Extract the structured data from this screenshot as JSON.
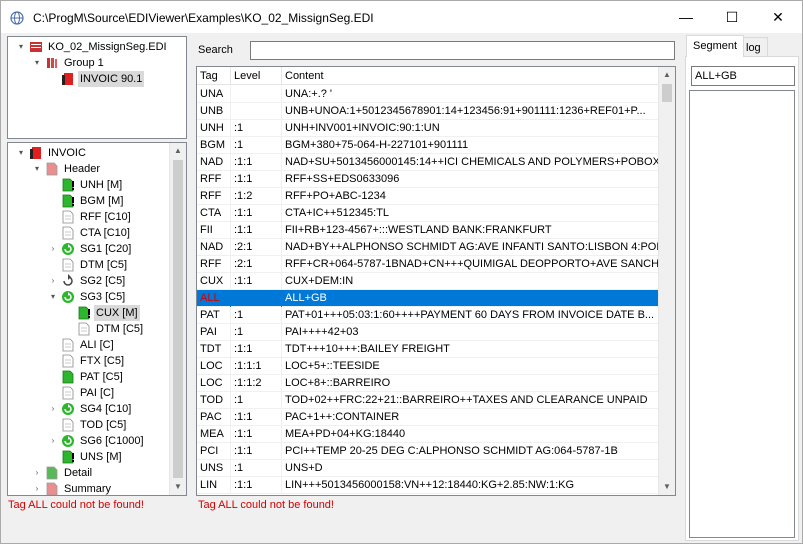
{
  "window": {
    "title": "C:\\ProgM\\Source\\EDIViewer\\Examples\\KO_02_MissignSeg.EDI",
    "minimize": "—",
    "maximize": "☐",
    "close": "✕"
  },
  "file_tree": {
    "items": [
      {
        "label": "KO_02_MissignSeg.EDI",
        "icon": "edi-file-icon",
        "level": 0,
        "arrow": "▾"
      },
      {
        "label": "Group 1",
        "icon": "group-icon",
        "level": 1,
        "arrow": "▾"
      },
      {
        "label": "INVOIC 90.1",
        "icon": "invoic-icon",
        "level": 2,
        "arrow": ""
      }
    ]
  },
  "segment_tree": {
    "items": [
      {
        "label": "INVOIC",
        "icon": "invoic-red-icon",
        "level": 0,
        "arrow": "▾"
      },
      {
        "label": "Header",
        "icon": "header-icon",
        "level": 1,
        "arrow": "▾"
      },
      {
        "label": "UNH [M]",
        "icon": "green-doc-warning-icon",
        "level": 2,
        "arrow": ""
      },
      {
        "label": "BGM [M]",
        "icon": "green-doc-warning-icon",
        "level": 2,
        "arrow": ""
      },
      {
        "label": "RFF [C10]",
        "icon": "white-doc-icon",
        "level": 2,
        "arrow": ""
      },
      {
        "label": "CTA [C10]",
        "icon": "white-doc-icon",
        "level": 2,
        "arrow": ""
      },
      {
        "label": "SG1 [C20]",
        "icon": "green-cycle-icon",
        "level": 2,
        "arrow": "›"
      },
      {
        "label": "DTM [C5]",
        "icon": "white-doc-icon",
        "level": 2,
        "arrow": ""
      },
      {
        "label": "SG2 [C5]",
        "icon": "gray-cycle-icon",
        "level": 2,
        "arrow": "›"
      },
      {
        "label": "SG3 [C5]",
        "icon": "green-cycle-icon",
        "level": 2,
        "arrow": "▾"
      },
      {
        "label": "CUX [M]",
        "icon": "green-doc-warning-icon",
        "level": 3,
        "arrow": ""
      },
      {
        "label": "DTM [C5]",
        "icon": "white-doc-icon",
        "level": 3,
        "arrow": ""
      },
      {
        "label": "ALI [C]",
        "icon": "white-doc-icon",
        "level": 2,
        "arrow": ""
      },
      {
        "label": "FTX [C5]",
        "icon": "white-doc-icon",
        "level": 2,
        "arrow": ""
      },
      {
        "label": "PAT [C5]",
        "icon": "green-doc-icon",
        "level": 2,
        "arrow": ""
      },
      {
        "label": "PAI [C]",
        "icon": "white-doc-icon",
        "level": 2,
        "arrow": ""
      },
      {
        "label": "SG4 [C10]",
        "icon": "green-cycle-icon",
        "level": 2,
        "arrow": "›"
      },
      {
        "label": "TOD [C5]",
        "icon": "white-doc-icon",
        "level": 2,
        "arrow": ""
      },
      {
        "label": "SG6 [C1000]",
        "icon": "green-cycle-icon",
        "level": 2,
        "arrow": "›"
      },
      {
        "label": "UNS [M]",
        "icon": "green-doc-warning-icon",
        "level": 2,
        "arrow": ""
      },
      {
        "label": "Detail",
        "icon": "detail-icon",
        "level": 1,
        "arrow": "›"
      },
      {
        "label": "Summary",
        "icon": "summary-icon",
        "level": 1,
        "arrow": "›"
      }
    ]
  },
  "left_error": "Tag ALL could not be found!",
  "search": {
    "label": "Search",
    "value": ""
  },
  "grid": {
    "headers": [
      "Tag",
      "Level",
      "Content"
    ],
    "rows": [
      {
        "tag": "UNA",
        "level": "",
        "content": "UNA:+.? '"
      },
      {
        "tag": "UNB",
        "level": "",
        "content": "UNB+UNOA:1+5012345678901:14+123456:91+901111:1236+REF01+P..."
      },
      {
        "tag": "UNH",
        "level": ":1",
        "content": "UNH+INV001+INVOIC:90:1:UN"
      },
      {
        "tag": "BGM",
        "level": ":1",
        "content": "BGM+380+75-064-H-227101+901111"
      },
      {
        "tag": "NAD",
        "level": ":1:1",
        "content": "NAD+SU+5013456000145:14++ICI CHEMICALS AND POLYMERS+POBOX..."
      },
      {
        "tag": "RFF",
        "level": ":1:1",
        "content": "RFF+SS+EDS0633096"
      },
      {
        "tag": "RFF",
        "level": ":1:2",
        "content": "RFF+PO+ABC-1234"
      },
      {
        "tag": "CTA",
        "level": ":1:1",
        "content": "CTA+IC++512345:TL"
      },
      {
        "tag": "FII",
        "level": ":1:1",
        "content": "FII+RB+123-4567+:::WESTLAND BANK:FRANKFURT"
      },
      {
        "tag": "NAD",
        "level": ":2:1",
        "content": "NAD+BY++ALPHONSO SCHMIDT AG:AVE INFANTI SANTO:LISBON 4:POR..."
      },
      {
        "tag": "RFF",
        "level": ":2:1",
        "content": "RFF+CR+064-5787-1BNAD+CN+++QUIMIGAL DEOPPORTO+AVE SANCH..."
      },
      {
        "tag": "CUX",
        "level": ":1:1",
        "content": "CUX+DEM:IN"
      },
      {
        "tag": "ALL",
        "level": "",
        "content": "ALL+GB"
      },
      {
        "tag": "PAT",
        "level": ":1",
        "content": "PAT+01+++05:03:1:60++++PAYMENT 60 DAYS FROM INVOICE DATE B..."
      },
      {
        "tag": "PAI",
        "level": ":1",
        "content": "PAI++++42+03"
      },
      {
        "tag": "TDT",
        "level": ":1:1",
        "content": "TDT+++10+++:BAILEY FREIGHT"
      },
      {
        "tag": "LOC",
        "level": ":1:1:1",
        "content": "LOC+5+::TEESIDE"
      },
      {
        "tag": "LOC",
        "level": ":1:1:2",
        "content": "LOC+8+::BARREIRO"
      },
      {
        "tag": "TOD",
        "level": ":1",
        "content": "TOD+02++FRC:22+21::BARREIRO++TAXES AND CLEARANCE UNPAID"
      },
      {
        "tag": "PAC",
        "level": ":1:1",
        "content": "PAC+1++:CONTAINER"
      },
      {
        "tag": "MEA",
        "level": ":1:1",
        "content": "MEA+PD+04+KG:18440"
      },
      {
        "tag": "PCI",
        "level": ":1:1",
        "content": "PCI++TEMP 20-25 DEG C:ALPHONSO SCHMIDT AG:064-5787-1B"
      },
      {
        "tag": "UNS",
        "level": ":1",
        "content": "UNS+D"
      },
      {
        "tag": "LIN",
        "level": ":1:1",
        "content": "LIN+++5013456000158:VN++12:18440:KG+2.85:NW:1:KG"
      }
    ]
  },
  "middle_error": "Tag ALL could not be found!",
  "right_panel": {
    "tabs": [
      "Segment",
      "log"
    ],
    "segment_value": "ALL+GB"
  },
  "colors": {
    "selection": "#0078d7",
    "error": "#d40000"
  }
}
